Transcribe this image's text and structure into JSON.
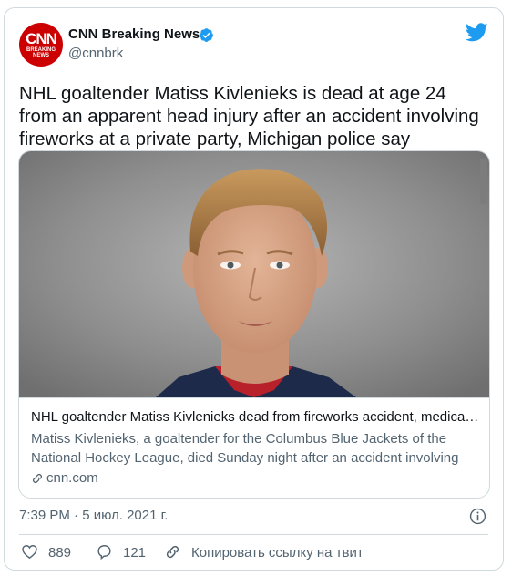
{
  "author": {
    "name": "CNN Breaking News",
    "handle": "@cnnbrk",
    "avatar_logo": "CNN",
    "avatar_sub_line1": "BREAKING",
    "avatar_sub_line2": "NEWS",
    "verified_icon": "verified-badge-icon",
    "brand_color": "#cc0000"
  },
  "platform_icon": "twitter-bird-icon",
  "tweet": {
    "text": "NHL goaltender Matiss Kivlenieks is dead at age 24 from an apparent head injury after an accident involving fireworks at a private party, Michigan police say"
  },
  "link_card": {
    "image": "player-headshot-photo",
    "title": "NHL goaltender Matiss Kivlenieks dead from fireworks accident, medical examiner says",
    "description": "Matiss Kivlenieks, a goaltender for the Columbus Blue Jackets of the National Hockey League, died Sunday night after an accident involving fireworks",
    "domain": "cnn.com"
  },
  "timestamp": "7:39 PM · 5 июл. 2021 г.",
  "actions": {
    "likes": "889",
    "replies": "121",
    "copy_link_label": "Копировать ссылку на твит"
  },
  "colors": {
    "twitter_blue": "#1d9bf0",
    "secondary_text": "#536471",
    "border": "#cfd9de"
  }
}
